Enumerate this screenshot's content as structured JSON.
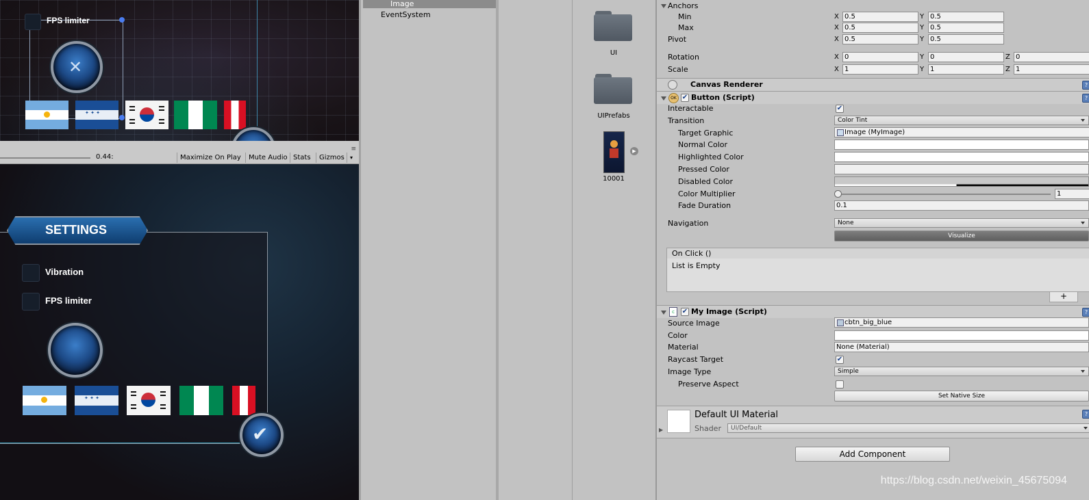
{
  "scene_view": {
    "fps_label": "FPS limiter"
  },
  "game_toolbar": {
    "scale_value": "0.44:",
    "buttons": [
      "Maximize On Play",
      "Mute Audio",
      "Stats",
      "Gizmos"
    ]
  },
  "game_view": {
    "title": "SETTINGS",
    "options": [
      "Vibration",
      "FPS limiter"
    ]
  },
  "hierarchy": {
    "items": [
      "Image",
      "EventSystem"
    ]
  },
  "project": {
    "assets": [
      {
        "label": "UI",
        "icon": "folder-icon"
      },
      {
        "label": "UIPrefabs",
        "icon": "folder-icon"
      },
      {
        "label": "10001",
        "icon": "sprite-thumbnail"
      }
    ]
  },
  "inspector": {
    "anchors": {
      "label": "Anchors",
      "min_label": "Min",
      "min_x": "0.5",
      "min_y": "0.5",
      "max_label": "Max",
      "max_x": "0.5",
      "max_y": "0.5"
    },
    "pivot": {
      "label": "Pivot",
      "x": "0.5",
      "y": "0.5"
    },
    "rotation": {
      "label": "Rotation",
      "x": "0",
      "y": "0",
      "z": "0"
    },
    "scale": {
      "label": "Scale",
      "x": "1",
      "y": "1",
      "z": "1"
    },
    "axis_letters": {
      "x": "X",
      "y": "Y",
      "z": "Z"
    },
    "canvas_renderer": {
      "title": "Canvas Renderer"
    },
    "button_script": {
      "title": "Button (Script)",
      "interactable_label": "Interactable",
      "transition_label": "Transition",
      "transition_value": "Color Tint",
      "target_graphic_label": "Target Graphic",
      "target_graphic_value": "Image (MyImage)",
      "normal_color_label": "Normal Color",
      "highlighted_color_label": "Highlighted Color",
      "pressed_color_label": "Pressed Color",
      "disabled_color_label": "Disabled Color",
      "color_multiplier_label": "Color Multiplier",
      "color_multiplier_value": "1",
      "fade_duration_label": "Fade Duration",
      "fade_duration_value": "0.1",
      "navigation_label": "Navigation",
      "navigation_value": "None",
      "visualize_label": "Visualize",
      "on_click_label": "On Click ()",
      "list_empty_label": "List is Empty",
      "add_label": "+"
    },
    "my_image_script": {
      "title": "My Image (Script)",
      "source_image_label": "Source Image",
      "source_image_value": "cbtn_big_blue",
      "color_label": "Color",
      "material_label": "Material",
      "material_value": "None (Material)",
      "raycast_label": "Raycast Target",
      "image_type_label": "Image Type",
      "image_type_value": "Simple",
      "preserve_aspect_label": "Preserve Aspect",
      "set_native_size_label": "Set Native Size"
    },
    "material": {
      "title": "Default UI Material",
      "shader_label": "Shader",
      "shader_value": "UI/Default"
    },
    "add_component_label": "Add Component"
  },
  "watermark": "https://blog.csdn.net/weixin_45675094"
}
